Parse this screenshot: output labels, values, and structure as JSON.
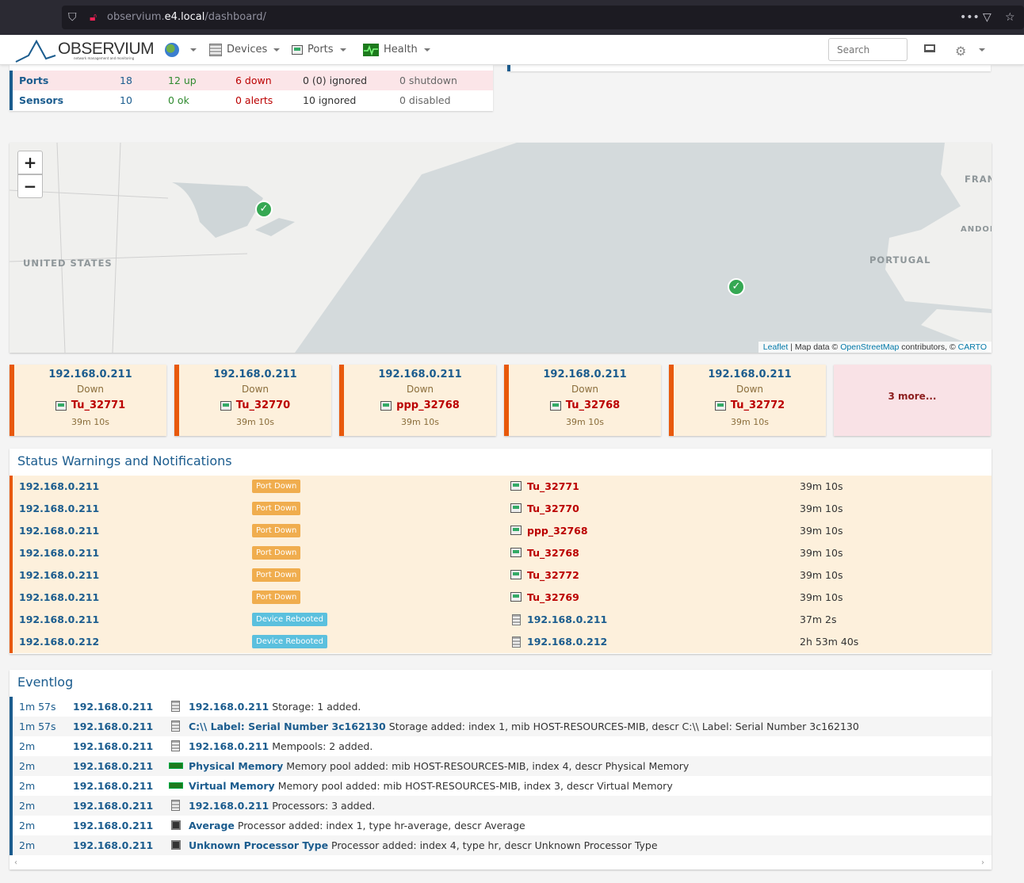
{
  "browser": {
    "url_host": "observium.e4.local",
    "url_path": "/dashboard/",
    "url_prefix": "observium."
  },
  "navbar": {
    "logo_text": "OBSERVIUM",
    "logo_sub": "network management and monitoring",
    "menu": [
      {
        "label": "Devices",
        "icon": "devices-icon"
      },
      {
        "label": "Ports",
        "icon": "ports-icon"
      },
      {
        "label": "Health",
        "icon": "health-icon"
      }
    ],
    "search_placeholder": "Search"
  },
  "stats": {
    "rows": [
      {
        "name": "Ports",
        "total": "18",
        "ok": "12 up",
        "bad": "6 down",
        "ignored": "0 (0) ignored",
        "disabled": "0 shutdown"
      },
      {
        "name": "Sensors",
        "total": "10",
        "ok": "0 ok",
        "bad": "0 alerts",
        "ignored": "10 ignored",
        "disabled": "0 disabled"
      }
    ]
  },
  "map": {
    "zoom_in": "+",
    "zoom_out": "−",
    "labels": [
      "UNITED STATES",
      "PORTUGAL",
      "FRAN",
      "ANDOR"
    ],
    "attribution_leaflet": "Leaflet",
    "attribution_mid": " | Map data © ",
    "attribution_osm": "OpenStreetMap",
    "attribution_mid2": " contributors, © ",
    "attribution_carto": "CARTO"
  },
  "alerts": [
    {
      "ip": "192.168.0.211",
      "status": "Down",
      "port": "Tu_32771",
      "time": "39m 10s"
    },
    {
      "ip": "192.168.0.211",
      "status": "Down",
      "port": "Tu_32770",
      "time": "39m 10s"
    },
    {
      "ip": "192.168.0.211",
      "status": "Down",
      "port": "ppp_32768",
      "time": "39m 10s"
    },
    {
      "ip": "192.168.0.211",
      "status": "Down",
      "port": "Tu_32768",
      "time": "39m 10s"
    },
    {
      "ip": "192.168.0.211",
      "status": "Down",
      "port": "Tu_32772",
      "time": "39m 10s"
    }
  ],
  "alerts_more": "3 more...",
  "status": {
    "title": "Status Warnings and Notifications",
    "rows": [
      {
        "device": "192.168.0.211",
        "label": "Port Down",
        "entity": "Tu_32771",
        "time": "39m 10s"
      },
      {
        "device": "192.168.0.211",
        "label": "Port Down",
        "entity": "Tu_32770",
        "time": "39m 10s"
      },
      {
        "device": "192.168.0.211",
        "label": "Port Down",
        "entity": "ppp_32768",
        "time": "39m 10s"
      },
      {
        "device": "192.168.0.211",
        "label": "Port Down",
        "entity": "Tu_32768",
        "time": "39m 10s"
      },
      {
        "device": "192.168.0.211",
        "label": "Port Down",
        "entity": "Tu_32772",
        "time": "39m 10s"
      },
      {
        "device": "192.168.0.211",
        "label": "Port Down",
        "entity": "Tu_32769",
        "time": "39m 10s"
      },
      {
        "device": "192.168.0.211",
        "label": "Device Rebooted",
        "entity": "192.168.0.211",
        "time": "37m 2s"
      },
      {
        "device": "192.168.0.212",
        "label": "Device Rebooted",
        "entity": "192.168.0.212",
        "time": "2h 53m 40s"
      }
    ]
  },
  "eventlog": {
    "title": "Eventlog",
    "rows": [
      {
        "time": "1m 57s",
        "device": "192.168.0.211",
        "entity": "192.168.0.211",
        "message": "Storage: 1 added."
      },
      {
        "time": "1m 57s",
        "device": "192.168.0.211",
        "entity": "C:\\\\ Label: Serial Number 3c162130",
        "message": "Storage added: index 1, mib HOST-RESOURCES-MIB, descr C:\\\\ Label: Serial Number 3c162130"
      },
      {
        "time": "2m",
        "device": "192.168.0.211",
        "entity": "192.168.0.211",
        "message": "Mempools: 2 added."
      },
      {
        "time": "2m",
        "device": "192.168.0.211",
        "entity": "Physical Memory",
        "message": "Memory pool added: mib HOST-RESOURCES-MIB, index 4, descr Physical Memory"
      },
      {
        "time": "2m",
        "device": "192.168.0.211",
        "entity": "Virtual Memory",
        "message": "Memory pool added: mib HOST-RESOURCES-MIB, index 3, descr Virtual Memory"
      },
      {
        "time": "2m",
        "device": "192.168.0.211",
        "entity": "192.168.0.211",
        "message": "Processors: 3 added."
      },
      {
        "time": "2m",
        "device": "192.168.0.211",
        "entity": "Average",
        "message": "Processor added: index 1, type hr-average, descr Average"
      },
      {
        "time": "2m",
        "device": "192.168.0.211",
        "entity": "Unknown Processor Type",
        "message": "Processor added: index 4, type hr, descr Unknown Processor Type"
      }
    ]
  },
  "colors": {
    "accent": "#1b5c8e",
    "down": "#e8590c",
    "warning_bg": "#fdf0dc",
    "ok": "#35a853"
  }
}
